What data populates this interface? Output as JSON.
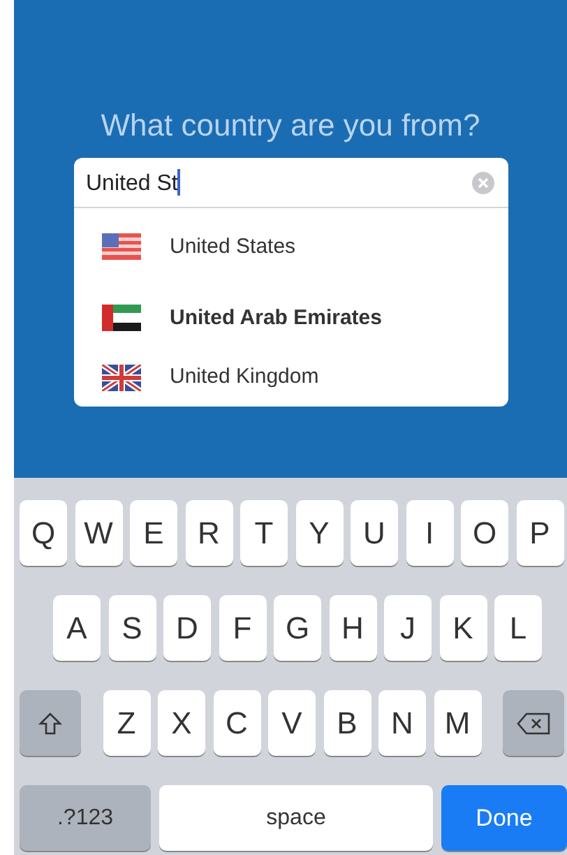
{
  "prompt": {
    "title": "What country are you from?"
  },
  "search": {
    "value": "United St",
    "clearable": true
  },
  "suggestions": [
    {
      "label": "United States",
      "kind": "us"
    },
    {
      "label": "United Arab Emirates",
      "kind": "ae"
    },
    {
      "label": "United Kingdom",
      "kind": "gb"
    }
  ],
  "keyboard": {
    "rows": [
      [
        {
          "kind": "letter",
          "label": "Q"
        },
        {
          "kind": "letter",
          "label": "W"
        },
        {
          "kind": "letter",
          "label": "E"
        },
        {
          "kind": "letter",
          "label": "R"
        },
        {
          "kind": "letter",
          "label": "T"
        },
        {
          "kind": "letter",
          "label": "Y"
        },
        {
          "kind": "letter",
          "label": "U"
        },
        {
          "kind": "letter",
          "label": "I"
        },
        {
          "kind": "letter",
          "label": "O"
        },
        {
          "kind": "letter",
          "label": "P"
        }
      ],
      [
        {
          "kind": "letter",
          "label": "A"
        },
        {
          "kind": "letter",
          "label": "S"
        },
        {
          "kind": "letter",
          "label": "D"
        },
        {
          "kind": "letter",
          "label": "F"
        },
        {
          "kind": "letter",
          "label": "G"
        },
        {
          "kind": "letter",
          "label": "H"
        },
        {
          "kind": "letter",
          "label": "J"
        },
        {
          "kind": "letter",
          "label": "K"
        },
        {
          "kind": "letter",
          "label": "L"
        }
      ],
      [
        {
          "kind": "shift"
        },
        {
          "kind": "letter",
          "label": "Z"
        },
        {
          "kind": "letter",
          "label": "X"
        },
        {
          "kind": "letter",
          "label": "C"
        },
        {
          "kind": "letter",
          "label": "V"
        },
        {
          "kind": "letter",
          "label": "B"
        },
        {
          "kind": "letter",
          "label": "N"
        },
        {
          "kind": "letter",
          "label": "M"
        },
        {
          "kind": "delete"
        }
      ]
    ],
    "bottom_keys": [
      {
        "kind": "mode",
        "label": ".?123"
      },
      {
        "kind": "space",
        "label": "space"
      },
      {
        "kind": "action",
        "label": "Done"
      }
    ]
  }
}
